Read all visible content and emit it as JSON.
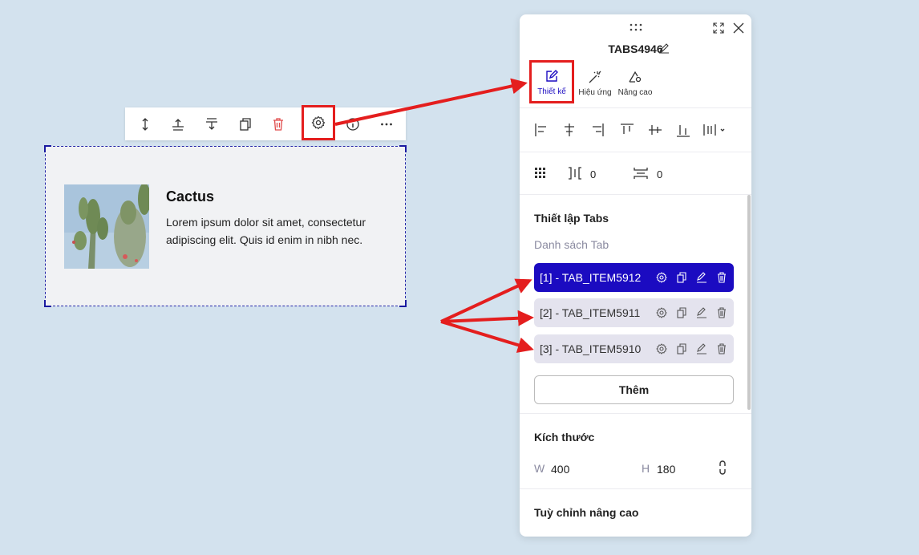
{
  "toolbar": {
    "buttons": [
      "move-vertical-icon",
      "insert-above-icon",
      "insert-below-icon",
      "duplicate-icon",
      "delete-icon",
      "settings-icon",
      "info-icon",
      "more-icon"
    ]
  },
  "element": {
    "title": "Cactus",
    "text": "Lorem ipsum dolor sit amet, consectetur adipiscing elit. Quis id enim in nibh nec."
  },
  "panel": {
    "title": "TABS4946",
    "tabs": [
      {
        "label": "Thiết kế",
        "icon": "edit-square-icon"
      },
      {
        "label": "Hiệu ứng",
        "icon": "magic-wand-icon"
      },
      {
        "label": "Nâng cao",
        "icon": "advanced-settings-icon"
      }
    ],
    "gap_value": "0",
    "spacing_value": "0",
    "tabs_settings": {
      "heading": "Thiết lập Tabs",
      "list_label": "Danh sách Tab",
      "items": [
        "[1] - TAB_ITEM5912",
        "[2] - TAB_ITEM5911",
        "[3] - TAB_ITEM5910"
      ],
      "add_label": "Thêm"
    },
    "size": {
      "heading": "Kích thước",
      "w_label": "W",
      "w_value": "400",
      "h_label": "H",
      "h_value": "180"
    },
    "advanced_heading": "Tuỳ chỉnh nâng cao"
  },
  "colors": {
    "background": "#d3e2ee",
    "accent": "#1b0bc1",
    "highlight": "#e41e1e",
    "delete": "#e04a4a"
  }
}
